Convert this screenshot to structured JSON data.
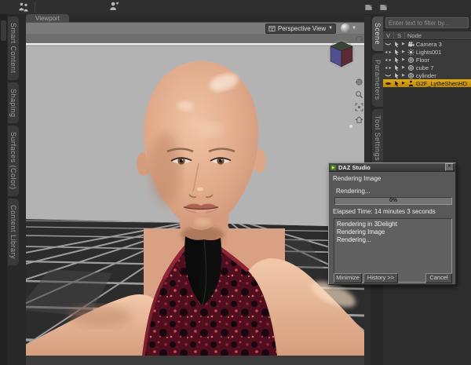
{
  "app": {
    "window_title": "DAZ Studio"
  },
  "toolbar": {
    "left_icons": [
      {
        "name": "paint-wand-tool",
        "glyph": "gi-brush"
      },
      {
        "name": "environment-scene",
        "glyph": "gi-scene"
      },
      {
        "name": "characters",
        "glyph": "gi-people"
      },
      {
        "name": "save-character",
        "glyph": "gi-savefig"
      },
      {
        "name": "save-pose",
        "glyph": "gi-savepose"
      }
    ],
    "render_icons": [
      {
        "name": "render-sphere",
        "glyph": "gi-rsphere",
        "active": false
      },
      {
        "name": "render-style",
        "glyph": "gi-rteapot",
        "active": false
      },
      {
        "name": "render-character",
        "glyph": "gi-rbust",
        "active": false
      },
      {
        "name": "render-settings",
        "glyph": "gi-rgear",
        "active": true
      }
    ]
  },
  "left_tabs": [
    "Smart Content",
    "Shaping",
    "Surfaces (Color)",
    "Content Library"
  ],
  "right_tabs": [
    {
      "label": "Scene",
      "active": true
    },
    {
      "label": "Parameters",
      "active": false
    },
    {
      "label": "Tool Settings",
      "active": false
    }
  ],
  "viewport": {
    "tab_label": "Viewport",
    "view_selector": "Perspective View",
    "dropdown_arrow": "▼",
    "controls": [
      "orbit-view",
      "rotate-gizmo",
      "zoom-view",
      "frame-view",
      "reset-home"
    ]
  },
  "scene_panel": {
    "filter_placeholder": "Enter text to filter by...",
    "columns": [
      "V",
      "S",
      "Node"
    ],
    "nodes": [
      {
        "label": "Camera 3",
        "icon": "camera",
        "visible": false,
        "selected": false
      },
      {
        "label": "Lights001",
        "icon": "light",
        "visible": true,
        "selected": false
      },
      {
        "label": "Floor",
        "icon": "prim",
        "visible": true,
        "selected": false
      },
      {
        "label": "cube 7",
        "icon": "prim",
        "visible": true,
        "selected": false
      },
      {
        "label": "cylinder",
        "icon": "prim",
        "visible": false,
        "selected": false
      },
      {
        "label": "G2F_LytheShenHD",
        "icon": "figure",
        "visible": true,
        "selected": true
      }
    ]
  },
  "render_dialog": {
    "title": "DAZ Studio",
    "close_label": "✕",
    "status_line": "Rendering Image",
    "sub_status": "Rendering...",
    "progress_percent": "0%",
    "elapsed": "Elapsed Time:  14 minutes 3 seconds",
    "log": [
      "Rendering in 3Delight",
      "Rendering Image",
      "Rendering..."
    ],
    "buttons": {
      "minimize": "Minimize",
      "history": "History >>",
      "cancel": "Cancel"
    }
  },
  "colors": {
    "selection_yellow": "#d89f0b",
    "toolbar_active_orange": "#f0a812",
    "chrome_dark": "#2e2e2e",
    "viewport_gray": "#b2b2b2",
    "dialog_gray": "#585858",
    "garment_red": "#5d1322",
    "skin_tone": "#e2a98b"
  }
}
